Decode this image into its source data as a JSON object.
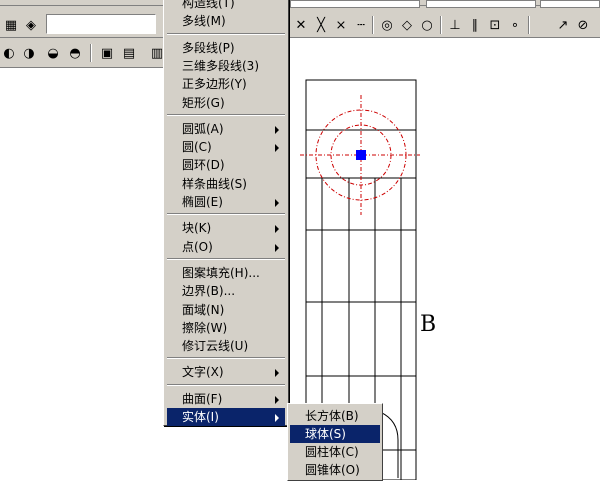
{
  "menu": {
    "items": [
      {
        "label": "构造线(T)",
        "submenu": false
      },
      {
        "label": "多线(M)",
        "submenu": false
      },
      {
        "label": "多段线(P)",
        "submenu": false
      },
      {
        "label": "三维多段线(3)",
        "submenu": false
      },
      {
        "label": "正多边形(Y)",
        "submenu": false
      },
      {
        "label": "矩形(G)",
        "submenu": false
      },
      {
        "label": "圆弧(A)",
        "submenu": true
      },
      {
        "label": "圆(C)",
        "submenu": true
      },
      {
        "label": "圆环(D)",
        "submenu": false
      },
      {
        "label": "样条曲线(S)",
        "submenu": false
      },
      {
        "label": "椭圆(E)",
        "submenu": true
      },
      {
        "label": "块(K)",
        "submenu": true
      },
      {
        "label": "点(O)",
        "submenu": true
      },
      {
        "label": "图案填充(H)...",
        "submenu": false
      },
      {
        "label": "边界(B)...",
        "submenu": false
      },
      {
        "label": "面域(N)",
        "submenu": false
      },
      {
        "label": "擦除(W)",
        "submenu": false
      },
      {
        "label": "修订云线(U)",
        "submenu": false
      },
      {
        "label": "文字(X)",
        "submenu": true
      },
      {
        "label": "曲面(F)",
        "submenu": true
      },
      {
        "label": "实体(I)",
        "submenu": true,
        "selected": true
      }
    ]
  },
  "submenu": {
    "items": [
      {
        "label": "长方体(B)"
      },
      {
        "label": "球体(S)",
        "selected": true
      },
      {
        "label": "圆柱体(C)"
      },
      {
        "label": "圆锥体(O)"
      }
    ]
  },
  "drawing": {
    "label": "B"
  },
  "colors": {
    "menu_bg": "#d4d0c8",
    "selection": "#0a246a",
    "centerline": "#cc0000",
    "grip": "#0000ff"
  }
}
